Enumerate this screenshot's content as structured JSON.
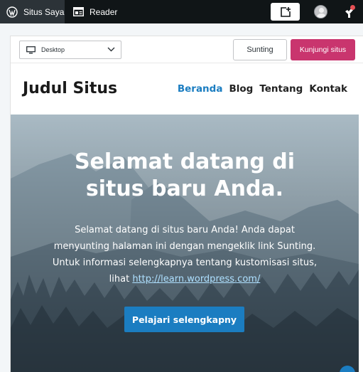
{
  "masterbar": {
    "my_sites_label": "Situs Saya",
    "reader_label": "Reader",
    "icons": [
      "wordpress-icon",
      "reader-icon",
      "write-icon",
      "avatar",
      "notifications-icon"
    ]
  },
  "toolbar": {
    "device_value": "Desktop",
    "edit_label": "Sunting",
    "visit_label": "Kunjungi situs",
    "accent": "#c9356e"
  },
  "site": {
    "title": "Judul Situs",
    "nav": [
      "Beranda",
      "Blog",
      "Tentang",
      "Kontak"
    ],
    "nav_active_color": "#1b7dc1"
  },
  "hero": {
    "title": "Selamat datang di situs baru Anda.",
    "text": "Selamat datang di situs baru Anda! Anda dapat menyunting halaman ini dengan mengeklik link Sunting. Untuk informasi selengkapnya tentang kustomisasi situs, lihat",
    "link_text": "http://learn.wordpress.com/",
    "button_label": "Pelajari selengkapny"
  }
}
